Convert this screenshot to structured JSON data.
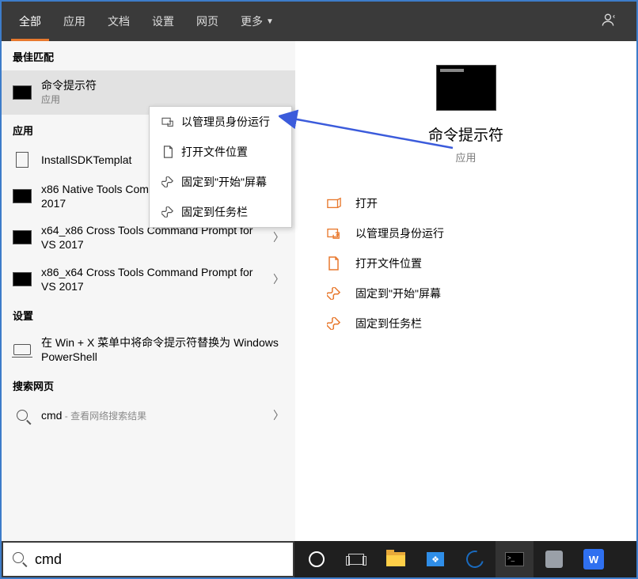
{
  "header": {
    "tabs": [
      "全部",
      "应用",
      "文档",
      "设置",
      "网页",
      "更多"
    ],
    "active_tab": 0
  },
  "left": {
    "best_match_header": "最佳匹配",
    "best_match": {
      "title": "命令提示符",
      "subtitle": "应用"
    },
    "apps_header": "应用",
    "apps": [
      {
        "title": "InstallSDKTemplat"
      },
      {
        "title": "x86 Native Tools Command Prompt for VS 2017"
      },
      {
        "title": "x64_x86 Cross Tools Command Prompt for VS 2017"
      },
      {
        "title": "x86_x64 Cross Tools Command Prompt for VS 2017"
      }
    ],
    "settings_header": "设置",
    "settings": [
      {
        "title": "在 Win + X 菜单中将命令提示符替换为 Windows PowerShell"
      }
    ],
    "web_header": "搜索网页",
    "web": {
      "query": "cmd",
      "suffix": " - 查看网络搜索结果"
    }
  },
  "context_menu": {
    "items": [
      "以管理员身份运行",
      "打开文件位置",
      "固定到\"开始\"屏幕",
      "固定到任务栏"
    ]
  },
  "right": {
    "title": "命令提示符",
    "subtitle": "应用",
    "actions": [
      "打开",
      "以管理员身份运行",
      "打开文件位置",
      "固定到\"开始\"屏幕",
      "固定到任务栏"
    ]
  },
  "search": {
    "value": "cmd"
  },
  "taskbar": {
    "items": [
      "cortana",
      "task-view",
      "file-explorer",
      "microsoft-store",
      "edge",
      "terminal",
      "settings-3d",
      "wps"
    ]
  }
}
